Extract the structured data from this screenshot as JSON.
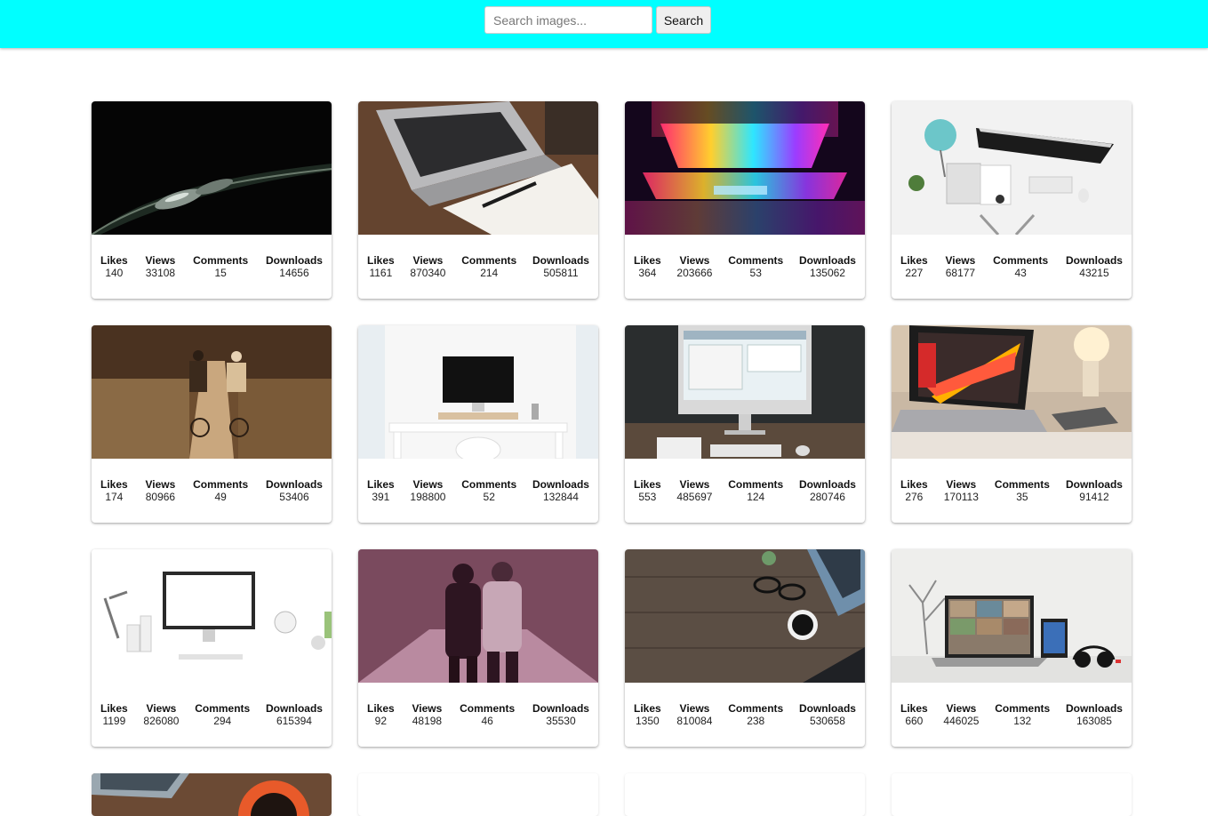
{
  "search": {
    "placeholder": "Search images...",
    "button_label": "Search"
  },
  "stat_labels": {
    "likes": "Likes",
    "views": "Views",
    "comments": "Comments",
    "downloads": "Downloads"
  },
  "cards": [
    {
      "subject": "water-drop-leaf",
      "likes": "140",
      "views": "33108",
      "comments": "15",
      "downloads": "14656"
    },
    {
      "subject": "laptop-notebook-desk",
      "likes": "1161",
      "views": "870340",
      "comments": "214",
      "downloads": "505811"
    },
    {
      "subject": "colorful-laptop",
      "likes": "364",
      "views": "203666",
      "comments": "53",
      "downloads": "135062"
    },
    {
      "subject": "white-desk-workspace",
      "likes": "227",
      "views": "68177",
      "comments": "43",
      "downloads": "43215"
    },
    {
      "subject": "cyclists-path",
      "likes": "174",
      "views": "80966",
      "comments": "49",
      "downloads": "53406"
    },
    {
      "subject": "imac-white-room",
      "likes": "391",
      "views": "198800",
      "comments": "52",
      "downloads": "132844"
    },
    {
      "subject": "imac-dark-desk",
      "likes": "553",
      "views": "485697",
      "comments": "124",
      "downloads": "280746"
    },
    {
      "subject": "laptop-lamp-desk",
      "likes": "276",
      "views": "170113",
      "comments": "35",
      "downloads": "91412"
    },
    {
      "subject": "imac-white-workspace",
      "likes": "1199",
      "views": "826080",
      "comments": "294",
      "downloads": "615394"
    },
    {
      "subject": "couple-walking",
      "likes": "92",
      "views": "48198",
      "comments": "46",
      "downloads": "35530"
    },
    {
      "subject": "wood-desk-coffee",
      "likes": "1350",
      "views": "810084",
      "comments": "238",
      "downloads": "530658"
    },
    {
      "subject": "laptop-tablet-headphones",
      "likes": "660",
      "views": "446025",
      "comments": "132",
      "downloads": "163085"
    }
  ],
  "colors": {
    "header": "#00ffff",
    "background": "#ffffff"
  }
}
